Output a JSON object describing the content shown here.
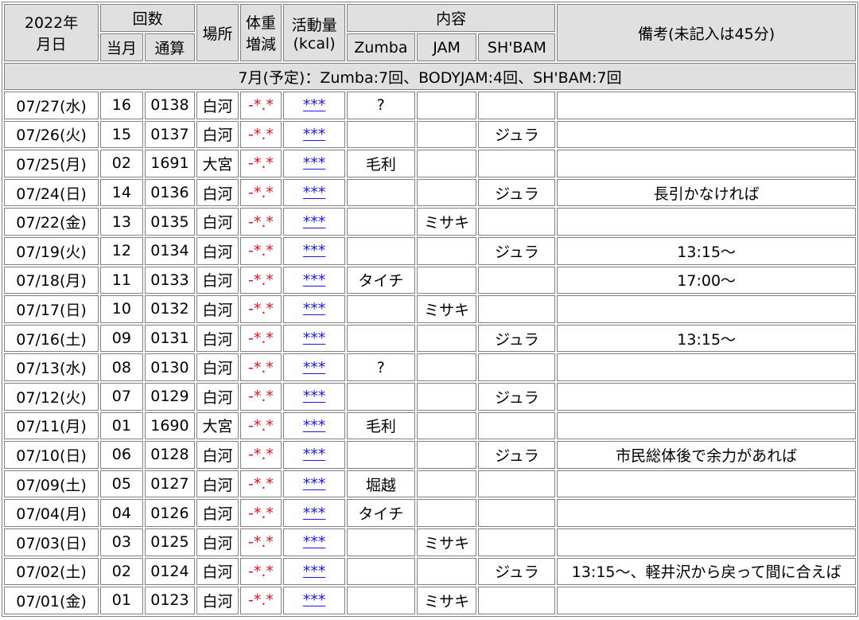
{
  "header": {
    "year": "2022年",
    "date_label": "月日",
    "count_label": "回数",
    "month_label": "当月",
    "total_label": "通算",
    "place_label": "場所",
    "weight_label_1": "体重",
    "weight_label_2": "増減",
    "activity_label_1": "活動量",
    "activity_label_2": "(kcal)",
    "content_label": "内容",
    "zumba_label": "Zumba",
    "jam_label": "JAM",
    "shbam_label": "SH'BAM",
    "note_label": "備考(未記入は45分)"
  },
  "plan": "7月(予定)：Zumba:7回、BODYJAM:4回、SH'BAM:7回",
  "rows": [
    {
      "date": "07/27(水)",
      "month": "16",
      "total": "0138",
      "place": "白河",
      "weight": "-*.*",
      "kcal": "***",
      "zumba": "?",
      "jam": "",
      "shbam": "",
      "note": ""
    },
    {
      "date": "07/26(火)",
      "month": "15",
      "total": "0137",
      "place": "白河",
      "weight": "-*.*",
      "kcal": "***",
      "zumba": "",
      "jam": "",
      "shbam": "ジュラ",
      "note": ""
    },
    {
      "date": "07/25(月)",
      "month": "02",
      "total": "1691",
      "place": "大宮",
      "weight": "-*.*",
      "kcal": "***",
      "zumba": "毛利",
      "jam": "",
      "shbam": "",
      "note": ""
    },
    {
      "date": "07/24(日)",
      "month": "14",
      "total": "0136",
      "place": "白河",
      "weight": "-*.*",
      "kcal": "***",
      "zumba": "",
      "jam": "",
      "shbam": "ジュラ",
      "note": "長引かなければ"
    },
    {
      "date": "07/22(金)",
      "month": "13",
      "total": "0135",
      "place": "白河",
      "weight": "-*.*",
      "kcal": "***",
      "zumba": "",
      "jam": "ミサキ",
      "shbam": "",
      "note": ""
    },
    {
      "date": "07/19(火)",
      "month": "12",
      "total": "0134",
      "place": "白河",
      "weight": "-*.*",
      "kcal": "***",
      "zumba": "",
      "jam": "",
      "shbam": "ジュラ",
      "note": "13:15～"
    },
    {
      "date": "07/18(月)",
      "month": "11",
      "total": "0133",
      "place": "白河",
      "weight": "-*.*",
      "kcal": "***",
      "zumba": "タイチ",
      "jam": "",
      "shbam": "",
      "note": "17:00～"
    },
    {
      "date": "07/17(日)",
      "month": "10",
      "total": "0132",
      "place": "白河",
      "weight": "-*.*",
      "kcal": "***",
      "zumba": "",
      "jam": "ミサキ",
      "shbam": "",
      "note": ""
    },
    {
      "date": "07/16(土)",
      "month": "09",
      "total": "0131",
      "place": "白河",
      "weight": "-*.*",
      "kcal": "***",
      "zumba": "",
      "jam": "",
      "shbam": "ジュラ",
      "note": "13:15～"
    },
    {
      "date": "07/13(水)",
      "month": "08",
      "total": "0130",
      "place": "白河",
      "weight": "-*.*",
      "kcal": "***",
      "zumba": "?",
      "jam": "",
      "shbam": "",
      "note": ""
    },
    {
      "date": "07/12(火)",
      "month": "07",
      "total": "0129",
      "place": "白河",
      "weight": "-*.*",
      "kcal": "***",
      "zumba": "",
      "jam": "",
      "shbam": "ジュラ",
      "note": ""
    },
    {
      "date": "07/11(月)",
      "month": "01",
      "total": "1690",
      "place": "大宮",
      "weight": "-*.*",
      "kcal": "***",
      "zumba": "毛利",
      "jam": "",
      "shbam": "",
      "note": ""
    },
    {
      "date": "07/10(日)",
      "month": "06",
      "total": "0128",
      "place": "白河",
      "weight": "-*.*",
      "kcal": "***",
      "zumba": "",
      "jam": "",
      "shbam": "ジュラ",
      "note": "市民総体後で余力があれば"
    },
    {
      "date": "07/09(土)",
      "month": "05",
      "total": "0127",
      "place": "白河",
      "weight": "-*.*",
      "kcal": "***",
      "zumba": "堀越",
      "jam": "",
      "shbam": "",
      "note": ""
    },
    {
      "date": "07/04(月)",
      "month": "04",
      "total": "0126",
      "place": "白河",
      "weight": "-*.*",
      "kcal": "***",
      "zumba": "タイチ",
      "jam": "",
      "shbam": "",
      "note": ""
    },
    {
      "date": "07/03(日)",
      "month": "03",
      "total": "0125",
      "place": "白河",
      "weight": "-*.*",
      "kcal": "***",
      "zumba": "",
      "jam": "ミサキ",
      "shbam": "",
      "note": ""
    },
    {
      "date": "07/02(土)",
      "month": "02",
      "total": "0124",
      "place": "白河",
      "weight": "-*.*",
      "kcal": "***",
      "zumba": "",
      "jam": "",
      "shbam": "ジュラ",
      "note": "13:15～、軽井沢から戻って間に合えば"
    },
    {
      "date": "07/01(金)",
      "month": "01",
      "total": "0123",
      "place": "白河",
      "weight": "-*.*",
      "kcal": "***",
      "zumba": "",
      "jam": "ミサキ",
      "shbam": "",
      "note": ""
    }
  ],
  "colors": {
    "header_bg": "#e0e0e0",
    "border": "#808080",
    "weight_text": "#e0141e",
    "kcal_link": "#1a1ae8"
  }
}
